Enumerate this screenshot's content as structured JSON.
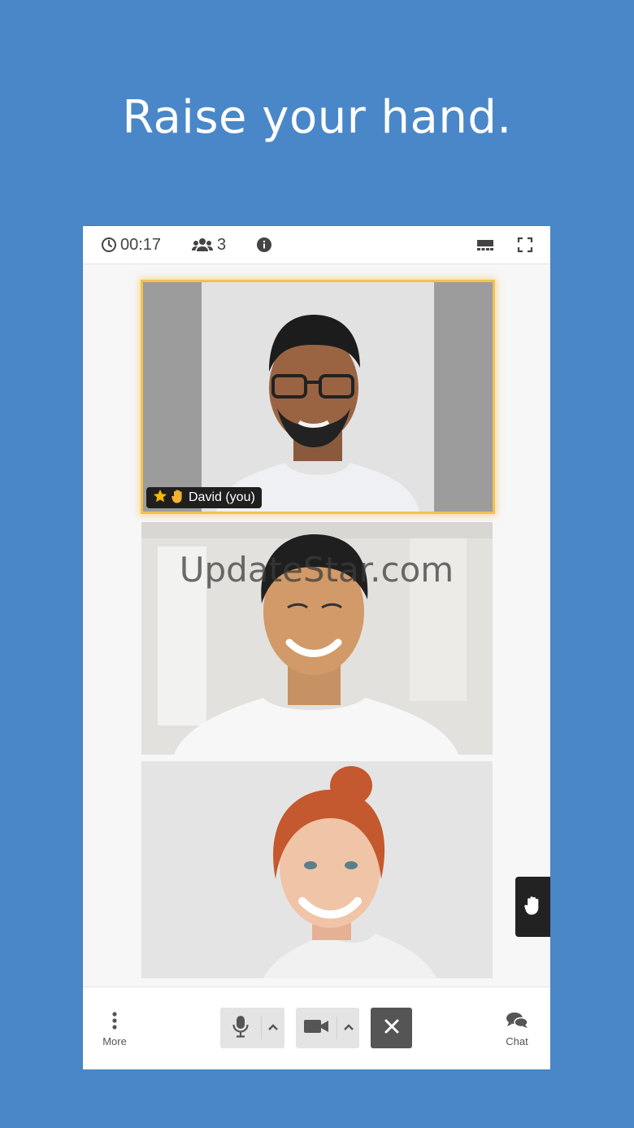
{
  "headline": "Raise your hand.",
  "topbar": {
    "timer": "00:17",
    "participants": "3",
    "icons": [
      "clock-icon",
      "people-icon",
      "info-icon",
      "layout-icon",
      "fullscreen-icon"
    ]
  },
  "tiles": [
    {
      "name": "David (you)",
      "badges": [
        "star-icon",
        "hand-icon"
      ],
      "highlight_color": "#f2c14e"
    },
    {
      "name": ""
    },
    {
      "name": ""
    }
  ],
  "watermark": "UpdateStar.com",
  "controls": {
    "more_label": "More",
    "chat_label": "Chat",
    "icons": [
      "more-icon",
      "microphone-icon",
      "chevron-up-icon",
      "video-camera-icon",
      "chevron-up-icon",
      "close-icon",
      "chat-icon",
      "raise-hand-icon"
    ]
  },
  "colors": {
    "background": "#4a87c8",
    "hangup": "#555555",
    "raise_hand_tab": "#222222"
  }
}
